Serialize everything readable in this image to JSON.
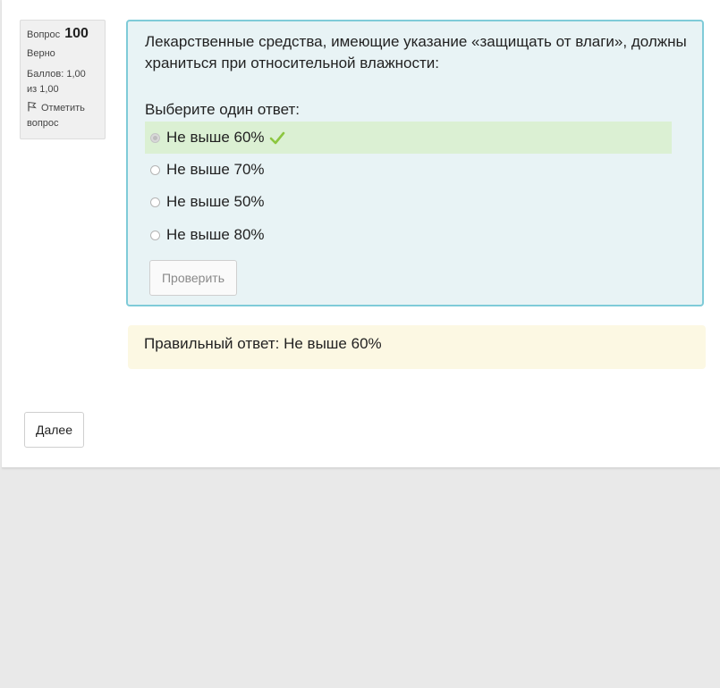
{
  "question": {
    "label": "Вопрос",
    "number": "100",
    "state": "Верно",
    "grade": "Баллов: 1,00 из 1,00",
    "flag_label": "Отметить вопрос",
    "text": "Лекарственные средства, имеющие указание «защищать от влаги», должны храниться при относительной влажности:",
    "prompt": "Выберите один ответ:",
    "answers": [
      {
        "label": "Не выше 60%",
        "selected": true,
        "correct": true
      },
      {
        "label": "Не выше 70%",
        "selected": false,
        "correct": false
      },
      {
        "label": "Не выше 50%",
        "selected": false,
        "correct": false
      },
      {
        "label": "Не выше 80%",
        "selected": false,
        "correct": false
      }
    ],
    "check_button": "Проверить",
    "feedback": "Правильный ответ: Не выше 60%"
  },
  "nav": {
    "next_button": "Далее"
  },
  "colors": {
    "correct_bg": "#dbf0d3",
    "check_mark": "#8cc63f",
    "feedback_bg": "#fcf8e3",
    "formulation_border": "#7fcbd8"
  },
  "icons": {
    "flag": "flag-icon",
    "correct": "check-mark-icon"
  }
}
